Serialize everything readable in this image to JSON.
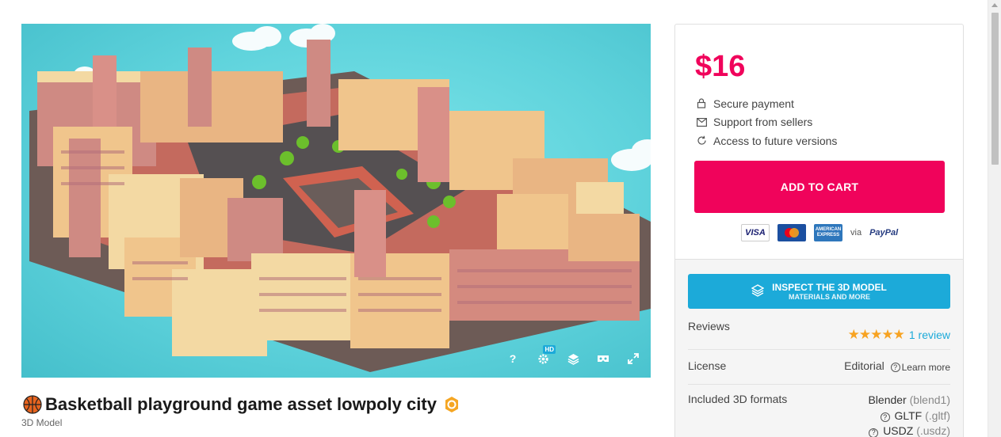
{
  "viewer": {
    "controls": {
      "help_label": "?",
      "hd_badge": "HD"
    }
  },
  "product": {
    "title": "Basketball playground game asset lowpoly city",
    "category": "3D Model"
  },
  "purchase": {
    "price": "$16",
    "features": [
      {
        "icon": "lock-icon",
        "label": "Secure payment"
      },
      {
        "icon": "mail-icon",
        "label": "Support from sellers"
      },
      {
        "icon": "refresh-icon",
        "label": "Access to future versions"
      }
    ],
    "cart_button": "ADD TO CART",
    "payments": {
      "visa": "VISA",
      "amex": "AMERICAN EXPRESS",
      "via": "via",
      "paypal": "PayPal"
    }
  },
  "details": {
    "inspect_main": "INSPECT THE 3D MODEL",
    "inspect_sub": "MATERIALS AND MORE",
    "reviews_label": "Reviews",
    "reviews_link": "1 review",
    "rating": 5,
    "license_label": "License",
    "license_value": "Editorial",
    "learn_more": "Learn more",
    "formats_label": "Included 3D formats",
    "formats": [
      {
        "name": "Blender",
        "ext": "(blend1)"
      },
      {
        "name": "GLTF",
        "ext": "(.gltf)"
      },
      {
        "name": "USDZ",
        "ext": "(.usdz)"
      }
    ]
  },
  "colors": {
    "accent": "#f0035b",
    "inspect": "#1caad9",
    "star": "#f7a322"
  }
}
